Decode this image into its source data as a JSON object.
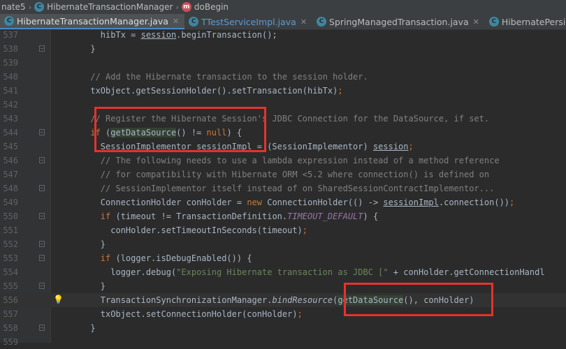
{
  "breadcrumb": {
    "items": [
      {
        "label": "nate5",
        "icon": "package-icon"
      },
      {
        "label": "HibernateTransactionManager",
        "icon": "class-icon",
        "badge": "C"
      },
      {
        "label": "doBegin",
        "icon": "method-icon",
        "badge": "m"
      }
    ]
  },
  "tabs": [
    {
      "label": "HibernateTransactionManager.java",
      "active": true,
      "badge": "C"
    },
    {
      "label": "TTestServiceImpl.java",
      "active": false,
      "badge": "C"
    },
    {
      "label": "SpringManagedTransaction.java",
      "active": false,
      "badge": "C"
    },
    {
      "label": "HibernatePersister.cl",
      "active": false,
      "badge": "C"
    }
  ],
  "editor": {
    "lines": [
      {
        "n": "537"
      },
      {
        "n": "538"
      },
      {
        "n": "539"
      },
      {
        "n": "540"
      },
      {
        "n": "541"
      },
      {
        "n": "542"
      },
      {
        "n": "543"
      },
      {
        "n": "544"
      },
      {
        "n": "545"
      },
      {
        "n": "546"
      },
      {
        "n": "547"
      },
      {
        "n": "548"
      },
      {
        "n": "549"
      },
      {
        "n": "550"
      },
      {
        "n": "551"
      },
      {
        "n": "552"
      },
      {
        "n": "553"
      },
      {
        "n": "554"
      },
      {
        "n": "555"
      },
      {
        "n": "556"
      },
      {
        "n": "557"
      },
      {
        "n": "558"
      },
      {
        "n": "559"
      }
    ]
  },
  "colors": {
    "background": "#2B2B2B",
    "gutter": "#313335",
    "keyword": "#CC7832",
    "comment": "#808080",
    "string": "#6A8759",
    "annotation_box": "#E5322D"
  }
}
